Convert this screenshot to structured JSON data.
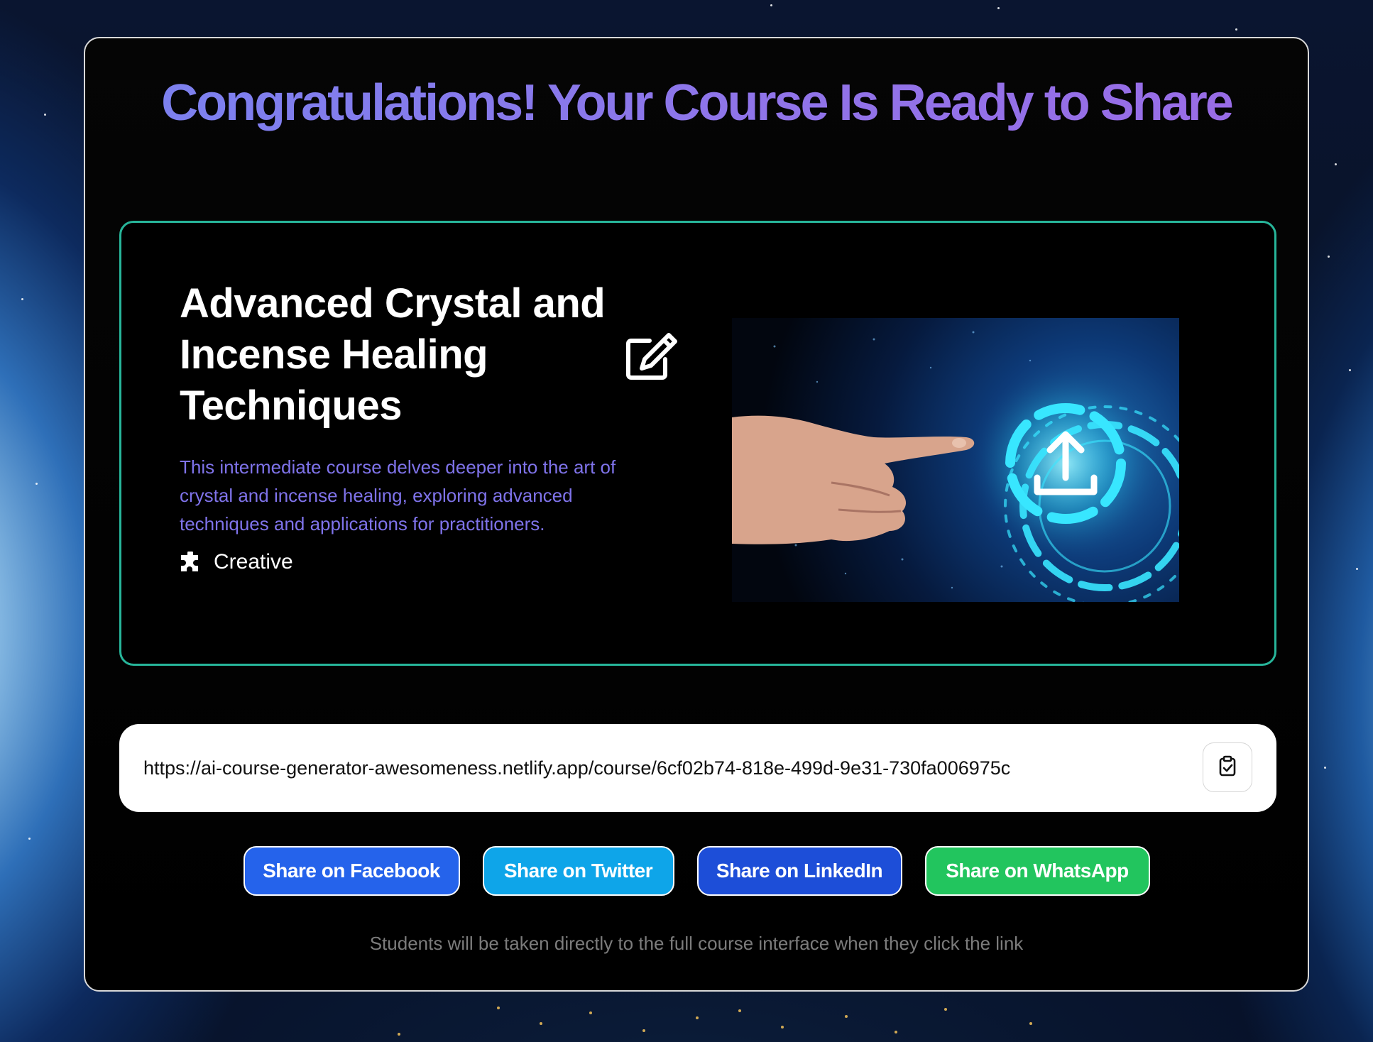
{
  "header": {
    "title": "Congratulations! Your Course Is Ready to Share"
  },
  "course": {
    "title": "Advanced Crystal and Incense Healing Techniques",
    "description": "This intermediate course delves deeper into the art of crystal and incense healing, exploring advanced techniques and applications for practitioners.",
    "category": "Creative",
    "category_icon": "puzzle-icon",
    "edit_icon": "edit-icon"
  },
  "share_link": {
    "url": "https://ai-course-generator-awesomeness.netlify.app/course/6cf02b74-818e-499d-9e31-730fa006975c",
    "copy_icon": "clipboard-check-icon"
  },
  "share_buttons": {
    "facebook": "Share on Facebook",
    "twitter": "Share on Twitter",
    "linkedin": "Share on LinkedIn",
    "whatsapp": "Share on WhatsApp"
  },
  "footer": {
    "note": "Students will be taken directly to the full course interface when they click the link"
  },
  "colors": {
    "heading": "#8a78ee",
    "card_border": "#27b59a",
    "description": "#7f73ea",
    "facebook": "#2563eb",
    "twitter": "#0ea5e9",
    "linkedin": "#1d4ed8",
    "whatsapp": "#22c55e"
  }
}
